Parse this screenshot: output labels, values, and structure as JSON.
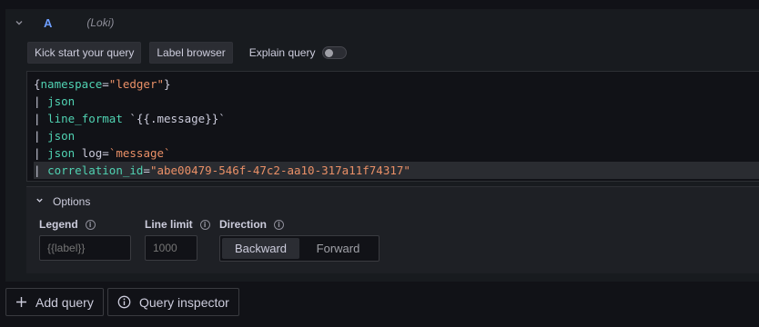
{
  "query_row": {
    "letter": "A",
    "datasource": "(Loki)"
  },
  "toolbar": {
    "kickstart_label": "Kick start your query",
    "label_browser_label": "Label browser",
    "explain_label": "Explain query",
    "explain_enabled": false
  },
  "editor": {
    "lines": [
      [
        {
          "t": "{",
          "c": "p"
        },
        {
          "t": "namespace",
          "c": "k"
        },
        {
          "t": "=",
          "c": "p"
        },
        {
          "t": "\"ledger\"",
          "c": "s"
        },
        {
          "t": "}",
          "c": "p"
        }
      ],
      [
        {
          "t": "| ",
          "c": "p"
        },
        {
          "t": "json",
          "c": "k"
        }
      ],
      [
        {
          "t": "| ",
          "c": "p"
        },
        {
          "t": "line_format",
          "c": "k"
        },
        {
          "t": " `{{.message}}`",
          "c": "p"
        }
      ],
      [
        {
          "t": "| ",
          "c": "p"
        },
        {
          "t": "json",
          "c": "k"
        }
      ],
      [
        {
          "t": "| ",
          "c": "p"
        },
        {
          "t": "json",
          "c": "k"
        },
        {
          "t": " log",
          "c": "p"
        },
        {
          "t": "=",
          "c": "p"
        },
        {
          "t": "`message`",
          "c": "s"
        }
      ],
      [
        {
          "t": "| ",
          "c": "p"
        },
        {
          "t": "correlation_id",
          "c": "k"
        },
        {
          "t": "=",
          "c": "p"
        },
        {
          "t": "\"abe00479-546f-47c2-aa10-317a11f74317\"",
          "c": "s"
        }
      ]
    ]
  },
  "options": {
    "title": "Options",
    "legend_label": "Legend",
    "legend_placeholder": "{{label}}",
    "line_limit_label": "Line limit",
    "line_limit_placeholder": "1000",
    "direction_label": "Direction",
    "direction_options": [
      "Backward",
      "Forward"
    ],
    "direction_selected": "Backward"
  },
  "actions": {
    "add_query_label": "Add query",
    "query_inspector_label": "Query inspector"
  },
  "colors": {
    "keyword": "#50d2b2",
    "string": "#ea9067",
    "accent_letter": "#6e9fff"
  }
}
